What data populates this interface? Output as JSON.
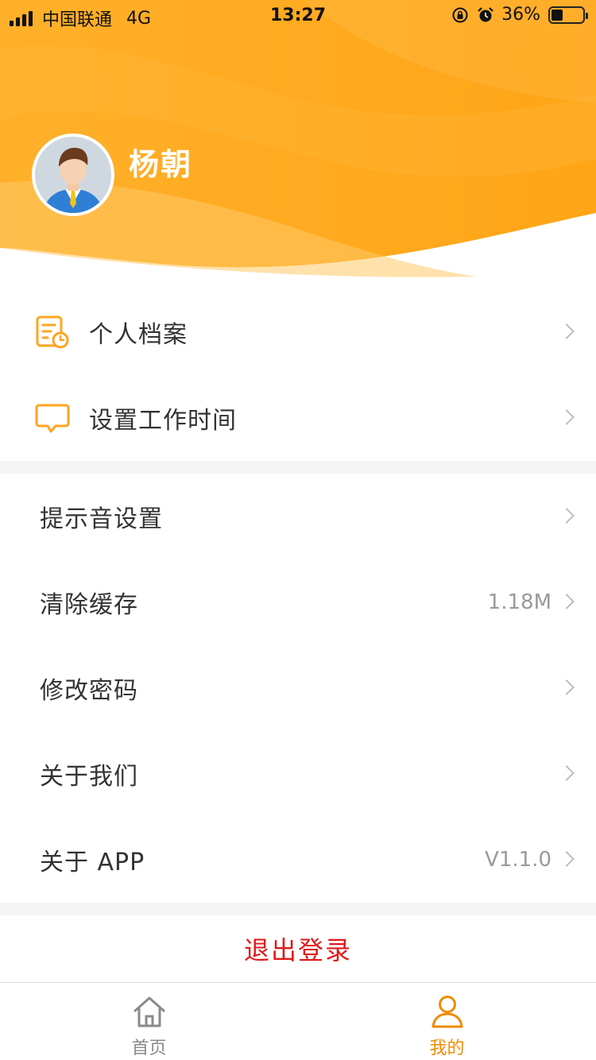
{
  "status_bar": {
    "carrier": "中国联通",
    "network": "4G",
    "time": "13:27",
    "battery": "36%",
    "battery_level": 0.36
  },
  "profile": {
    "name": "杨朝"
  },
  "menu_primary": [
    {
      "label": "个人档案",
      "icon": "profile-document-icon"
    },
    {
      "label": "设置工作时间",
      "icon": "chat-bubble-icon"
    }
  ],
  "menu_settings": [
    {
      "label": "提示音设置",
      "value": ""
    },
    {
      "label": "清除缓存",
      "value": "1.18M"
    },
    {
      "label": "修改密码",
      "value": ""
    },
    {
      "label": "关于我们",
      "value": ""
    },
    {
      "label": "关于 APP",
      "value": "V1.1.0"
    }
  ],
  "logout_label": "退出登录",
  "tabs": [
    {
      "label": "首页",
      "icon": "home-icon",
      "active": false
    },
    {
      "label": "我的",
      "icon": "user-icon",
      "active": true
    }
  ],
  "colors": {
    "accent": "#FFA51F",
    "accent_dark": "#F08C00",
    "logout": "#E01B1B"
  }
}
